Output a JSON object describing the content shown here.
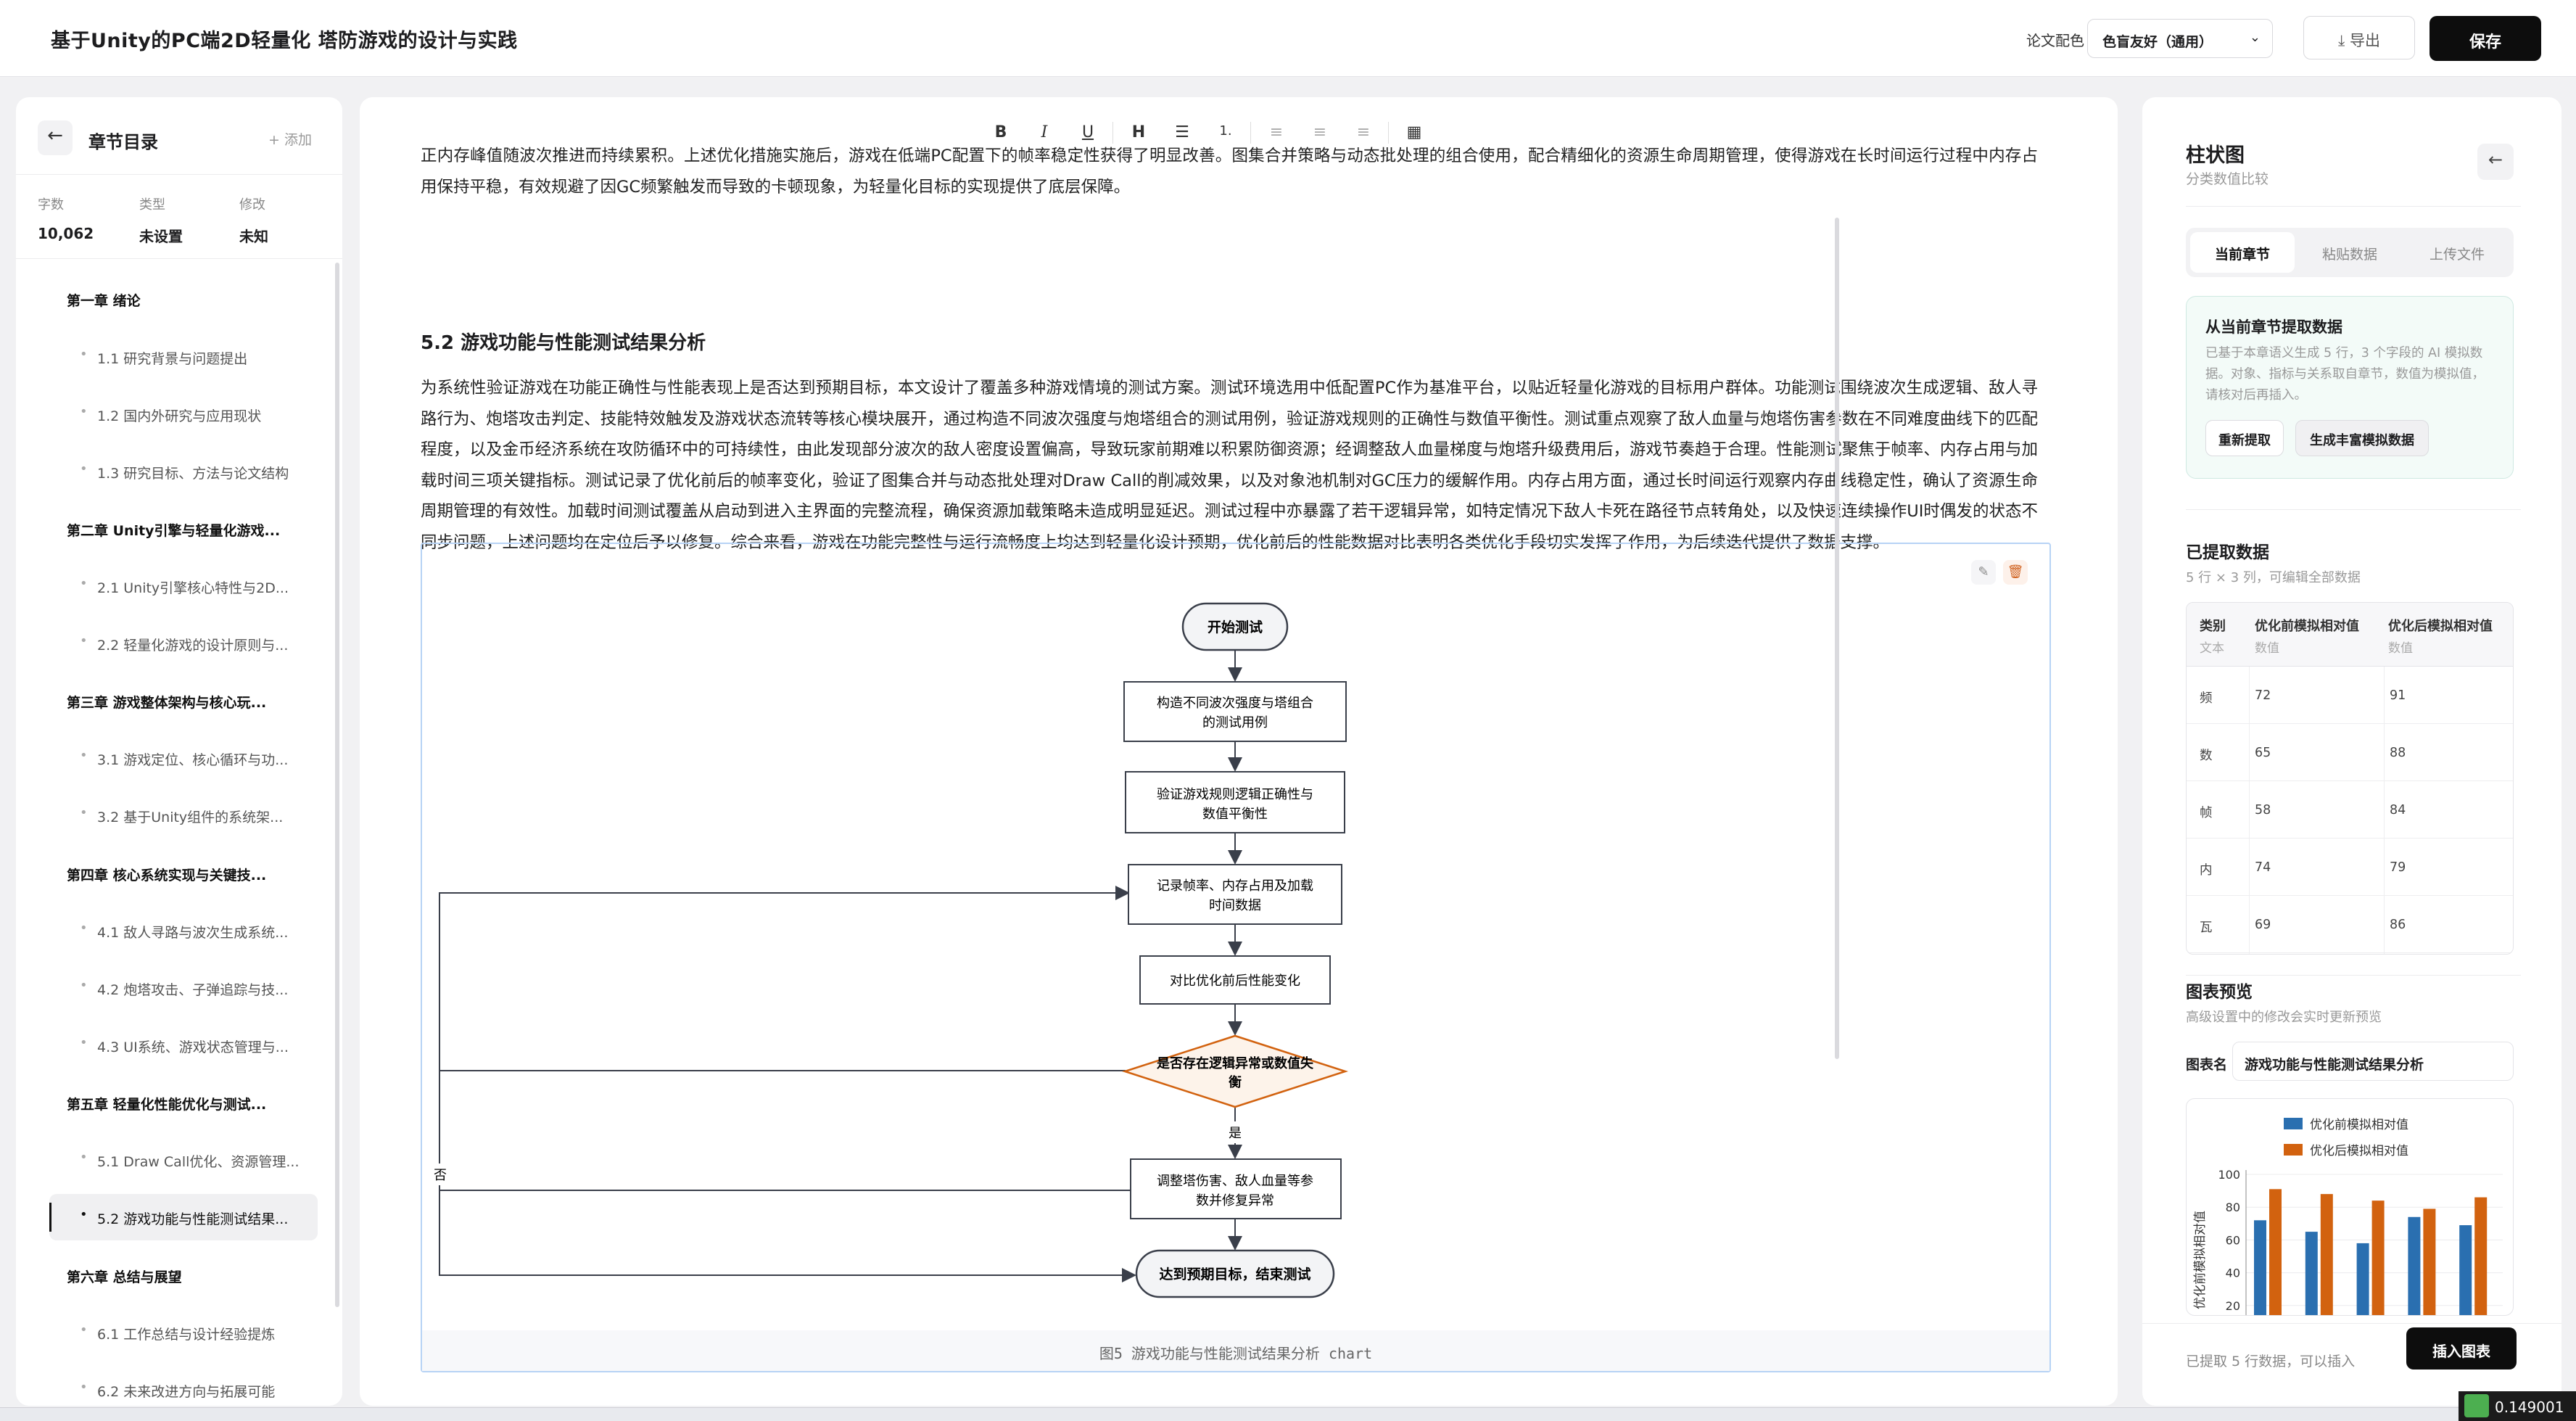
{
  "header": {
    "title": "基于Unity的PC端2D轻量化 塔防游戏的设计与实践",
    "scheme_label": "论文配色",
    "scheme_value": "色盲友好（通用）",
    "export_label": "导出",
    "save_label": "保存"
  },
  "sidebar": {
    "title": "章节目录",
    "add_label": "+ 添加",
    "stats": [
      {
        "key": "字数",
        "value": "10,062"
      },
      {
        "key": "类型",
        "value": "未设置"
      },
      {
        "key": "修改",
        "value": "未知"
      }
    ],
    "items": [
      {
        "label": "第一章 绪论",
        "level": "chapter"
      },
      {
        "label": "1.1 研究背景与问题提出",
        "level": "section"
      },
      {
        "label": "1.2 国内外研究与应用现状",
        "level": "section"
      },
      {
        "label": "1.3 研究目标、方法与论文结构",
        "level": "section"
      },
      {
        "label": "第二章 Unity引擎与轻量化游戏...",
        "level": "chapter"
      },
      {
        "label": "2.1 Unity引擎核心特性与2D...",
        "level": "section"
      },
      {
        "label": "2.2 轻量化游戏的设计原则与...",
        "level": "section"
      },
      {
        "label": "第三章 游戏整体架构与核心玩...",
        "level": "chapter"
      },
      {
        "label": "3.1 游戏定位、核心循环与功...",
        "level": "section"
      },
      {
        "label": "3.2 基于Unity组件的系统架...",
        "level": "section"
      },
      {
        "label": "第四章 核心系统实现与关键技...",
        "level": "chapter"
      },
      {
        "label": "4.1 敌人寻路与波次生成系统...",
        "level": "section"
      },
      {
        "label": "4.2 炮塔攻击、子弹追踪与技...",
        "level": "section"
      },
      {
        "label": "4.3 UI系统、游戏状态管理与...",
        "level": "section"
      },
      {
        "label": "第五章 轻量化性能优化与测试...",
        "level": "chapter"
      },
      {
        "label": "5.1 Draw Call优化、资源管理...",
        "level": "section"
      },
      {
        "label": "5.2 游戏功能与性能测试结果...",
        "level": "section",
        "active": true
      },
      {
        "label": "第六章 总结与展望",
        "level": "chapter"
      },
      {
        "label": "6.1 工作总结与设计经验提炼",
        "level": "section"
      },
      {
        "label": "6.2 未来改进方向与拓展可能",
        "level": "section"
      }
    ]
  },
  "editor": {
    "toolbar": [
      "B",
      "I",
      "U",
      "H",
      "☰",
      "1.",
      "≡",
      "≡",
      "≡",
      "▦"
    ],
    "top_paragraph": "正内存峰值随波次推进而持续累积。上述优化措施实施后，游戏在低端PC配置下的帧率稳定性获得了明显改善。图集合并策略与动态批处理的组合使用，配合精细化的资源生命周期管理，使得游戏在长时间运行过程中内存占用保持平稳，有效规避了因GC频繁触发而导致的卡顿现象，为轻量化目标的实现提供了底层保障。",
    "section_heading": "5.2 游戏功能与性能测试结果分析",
    "paragraph": "为系统性验证游戏在功能正确性与性能表现上是否达到预期目标，本文设计了覆盖多种游戏情境的测试方案。测试环境选用中低配置PC作为基准平台，以贴近轻量化游戏的目标用户群体。功能测试围绕波次生成逻辑、敌人寻路行为、炮塔攻击判定、技能特效触发及游戏状态流转等核心模块展开，通过构造不同波次强度与炮塔组合的测试用例，验证游戏规则的正确性与数值平衡性。测试重点观察了敌人血量与炮塔伤害参数在不同难度曲线下的匹配程度，以及金币经济系统在攻防循环中的可持续性，由此发现部分波次的敌人密度设置偏高，导致玩家前期难以积累防御资源；经调整敌人血量梯度与炮塔升级费用后，游戏节奏趋于合理。性能测试聚焦于帧率、内存占用与加载时间三项关键指标。测试记录了优化前后的帧率变化，验证了图集合并与动态批处理对Draw Call的削减效果，以及对象池机制对GC压力的缓解作用。内存占用方面，通过长时间运行观察内存曲线稳定性，确认了资源生命周期管理的有效性。加载时间测试覆盖从启动到进入主界面的完整流程，确保资源加载策略未造成明显延迟。测试过程中亦暴露了若干逻辑异常，如特定情况下敌人卡死在路径节点转角处，以及快速连续操作UI时偶发的状态不同步问题，上述问题均在定位后予以修复。综合来看，游戏在功能完整性与运行流畅度上均达到轻量化设计预期，优化前后的性能数据对比表明各类优化手段切实发挥了作用，为后续迭代提供了数据支撑。",
    "figure": {
      "caption": "图5 游戏功能与性能测试结果分析 chart",
      "nodes": {
        "start": "开始测试",
        "n1a": "构造不同波次强度与塔组合",
        "n1b": "的测试用例",
        "n2a": "验证游戏规则逻辑正确性与",
        "n2b": "数值平衡性",
        "n3a": "记录帧率、内存占用及加载",
        "n3b": "时间数据",
        "n4": "对比优化前后性能变化",
        "d1a": "是否存在逻辑异常或数值失",
        "d1b": "衡",
        "yes": "是",
        "no": "否",
        "n5a": "调整塔伤害、敌人血量等参",
        "n5b": "数并修复异常",
        "end": "达到预期目标，结束测试"
      }
    }
  },
  "panel": {
    "title": "柱状图",
    "subtitle": "分类数值比较",
    "tabs": [
      "当前章节",
      "粘贴数据",
      "上传文件"
    ],
    "active_tab": 0,
    "extract": {
      "title": "从当前章节提取数据",
      "desc": "已基于本章语义生成 5 行，3 个字段的 AI 模拟数据。对象、指标与关系取自章节，数值为模拟值，请核对后再插入。",
      "btn_reextract": "重新提取",
      "btn_generate": "生成丰富模拟数据"
    },
    "data_title": "已提取数据",
    "data_sub": "5 行 × 3 列，可编辑全部数据",
    "table": {
      "headers": [
        {
          "name": "类别",
          "type": "文本"
        },
        {
          "name": "优化前模拟相对值",
          "type": "数值"
        },
        {
          "name": "优化后模拟相对值",
          "type": "数值"
        }
      ],
      "rows": [
        [
          "频",
          "72",
          "91"
        ],
        [
          "数",
          "65",
          "88"
        ],
        [
          "帧",
          "58",
          "84"
        ],
        [
          "内",
          "74",
          "79"
        ],
        [
          "瓦",
          "69",
          "86"
        ]
      ]
    },
    "preview_title": "图表预览",
    "preview_sub": "高级设置中的修改会实时更新预览",
    "name_label": "图表名",
    "name_value": "游戏功能与性能测试结果分析",
    "footer_note": "已提取 5 行数据，可以插入",
    "insert_label": "插入图表"
  },
  "chart_data": {
    "type": "bar",
    "categories": [
      "频",
      "数",
      "帧",
      "内",
      "瓦"
    ],
    "series": [
      {
        "name": "优化前模拟相对值",
        "values": [
          72,
          65,
          58,
          74,
          69
        ],
        "color": "#2a6fb0"
      },
      {
        "name": "优化后模拟相对值",
        "values": [
          91,
          88,
          84,
          79,
          86
        ],
        "color": "#d2620f"
      }
    ],
    "ylabel": "优化前模拟相对值",
    "ylim": [
      0,
      100
    ],
    "yticks": [
      "100",
      "80",
      "60",
      "40",
      "20"
    ],
    "legend": "top"
  },
  "tray": {
    "text": "0.149001"
  }
}
